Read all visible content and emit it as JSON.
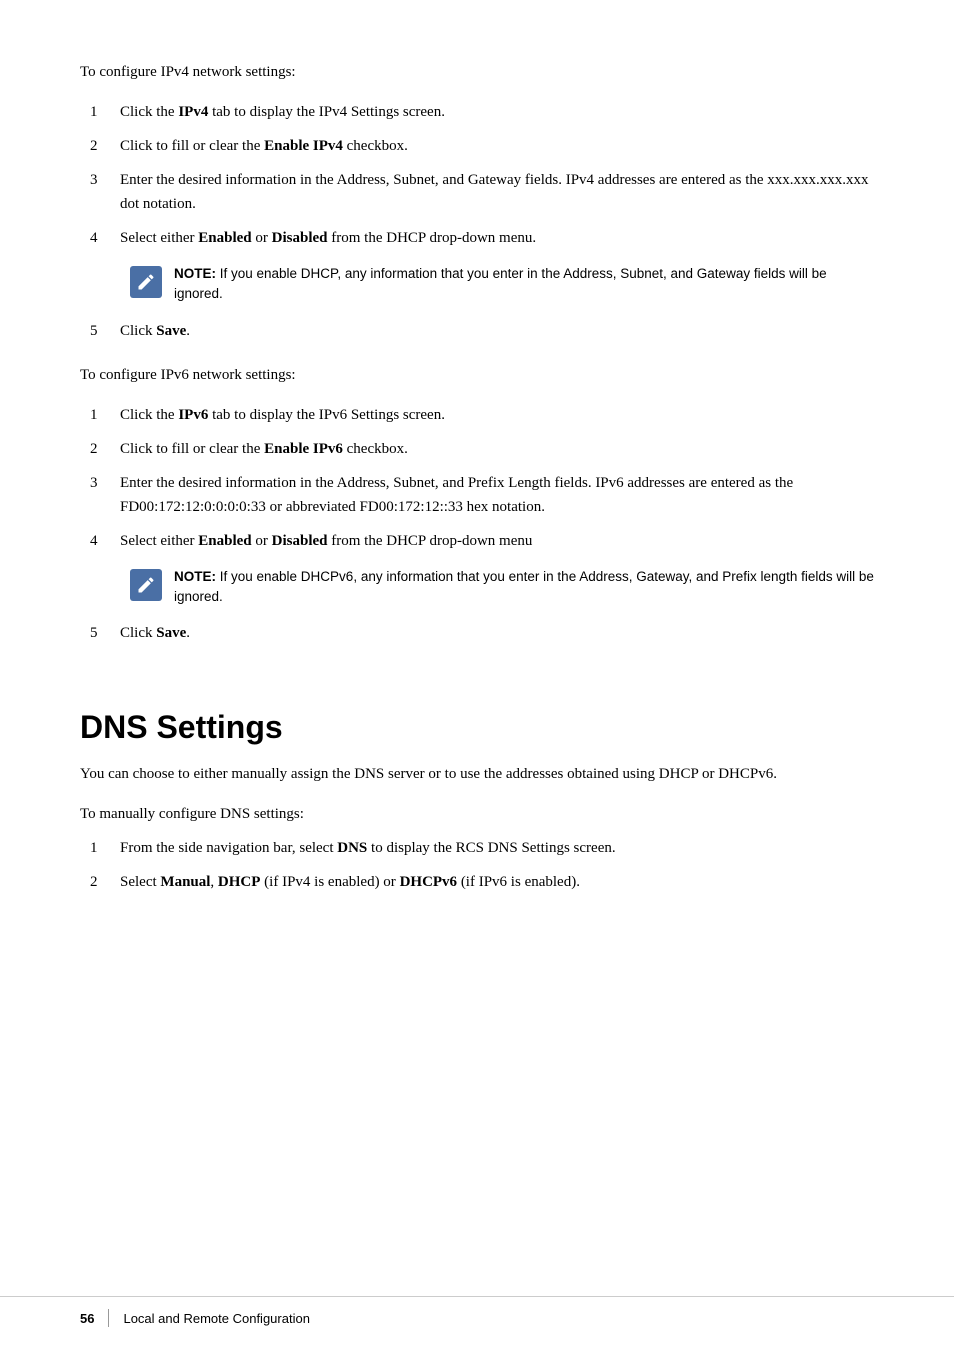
{
  "page": {
    "intro_ipv4": "To configure IPv4 network settings:",
    "ipv4_steps": [
      {
        "number": "1",
        "text_parts": [
          {
            "text": "Click the ",
            "bold": false
          },
          {
            "text": "IPv4",
            "bold": true
          },
          {
            "text": " tab to display the IPv4 Settings screen.",
            "bold": false
          }
        ]
      },
      {
        "number": "2",
        "text_parts": [
          {
            "text": "Click to fill or clear the ",
            "bold": false
          },
          {
            "text": "Enable IPv4",
            "bold": true
          },
          {
            "text": " checkbox.",
            "bold": false
          }
        ]
      },
      {
        "number": "3",
        "text_parts": [
          {
            "text": "Enter the desired information in the Address, Subnet, and Gateway fields. IPv4 addresses are entered as the xxx.xxx.xxx.xxx dot notation.",
            "bold": false
          }
        ]
      },
      {
        "number": "4",
        "text_parts": [
          {
            "text": "Select either ",
            "bold": false
          },
          {
            "text": "Enabled",
            "bold": true
          },
          {
            "text": " or ",
            "bold": false
          },
          {
            "text": "Disabled",
            "bold": true
          },
          {
            "text": " from the DHCP drop-down menu.",
            "bold": false
          }
        ]
      }
    ],
    "note_ipv4": {
      "label": "NOTE:",
      "text": " If you enable DHCP, any information that you enter in the Address, Subnet, and Gateway fields will be ignored."
    },
    "ipv4_step5": {
      "number": "5",
      "text_parts": [
        {
          "text": "Click ",
          "bold": false
        },
        {
          "text": "Save",
          "bold": true
        },
        {
          "text": ".",
          "bold": false
        }
      ]
    },
    "intro_ipv6": "To configure IPv6 network settings:",
    "ipv6_steps": [
      {
        "number": "1",
        "text_parts": [
          {
            "text": "Click the ",
            "bold": false
          },
          {
            "text": "IPv6",
            "bold": true
          },
          {
            "text": " tab to display the IPv6 Settings screen.",
            "bold": false
          }
        ]
      },
      {
        "number": "2",
        "text_parts": [
          {
            "text": "Click to fill or clear the ",
            "bold": false
          },
          {
            "text": "Enable IPv6",
            "bold": true
          },
          {
            "text": " checkbox.",
            "bold": false
          }
        ]
      },
      {
        "number": "3",
        "text_parts": [
          {
            "text": "Enter the desired information in the Address, Subnet, and Prefix Length fields. IPv6 addresses are entered as the FD00:172:12:0:0:0:0:33 or abbreviated FD00:172:12::33 hex notation.",
            "bold": false
          }
        ]
      },
      {
        "number": "4",
        "text_parts": [
          {
            "text": "Select either ",
            "bold": false
          },
          {
            "text": "Enabled",
            "bold": true
          },
          {
            "text": " or ",
            "bold": false
          },
          {
            "text": "Disabled",
            "bold": true
          },
          {
            "text": " from the DHCP drop-down menu",
            "bold": false
          }
        ]
      }
    ],
    "note_ipv6": {
      "label": "NOTE:",
      "text": " If you enable DHCPv6, any information that you enter in the Address, Gateway, and Prefix length fields will be ignored."
    },
    "ipv6_step5": {
      "number": "5",
      "text_parts": [
        {
          "text": "Click ",
          "bold": false
        },
        {
          "text": "Save",
          "bold": true
        },
        {
          "text": ".",
          "bold": false
        }
      ]
    },
    "dns_heading": "DNS Settings",
    "dns_intro1": "You can choose to either manually assign the DNS server or to use the addresses obtained using DHCP or DHCPv6.",
    "dns_intro2": "To manually configure DNS settings:",
    "dns_steps": [
      {
        "number": "1",
        "text_parts": [
          {
            "text": "From the side navigation bar, select ",
            "bold": false
          },
          {
            "text": "DNS",
            "bold": true
          },
          {
            "text": " to display the RCS DNS Settings screen.",
            "bold": false
          }
        ]
      },
      {
        "number": "2",
        "text_parts": [
          {
            "text": "Select ",
            "bold": false
          },
          {
            "text": "Manual",
            "bold": true
          },
          {
            "text": ", ",
            "bold": false
          },
          {
            "text": "DHCP",
            "bold": true
          },
          {
            "text": " (if IPv4 is enabled) or ",
            "bold": false
          },
          {
            "text": "DHCPv6",
            "bold": true
          },
          {
            "text": " (if IPv6 is enabled).",
            "bold": false
          }
        ]
      }
    ],
    "footer": {
      "page_number": "56",
      "separator": "|",
      "title": "Local and Remote Configuration"
    }
  }
}
